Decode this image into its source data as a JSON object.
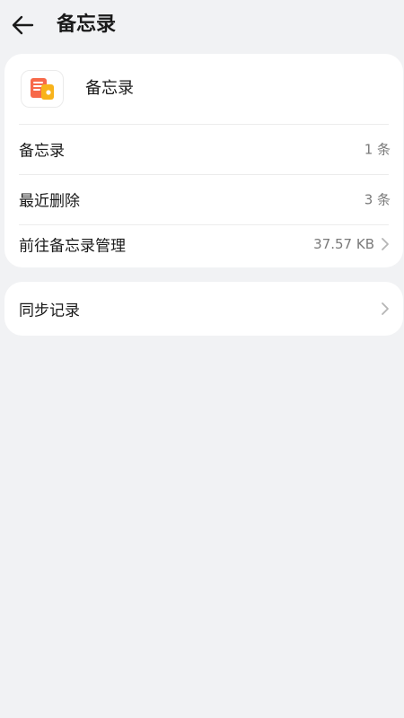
{
  "header": {
    "title": "备忘录",
    "back_icon": "back-arrow-icon"
  },
  "app": {
    "name": "备忘录",
    "icon": "notes-app-icon",
    "icon_colors": {
      "primary": "#f7694a",
      "secondary": "#f8b31b"
    }
  },
  "storage": {
    "rows": [
      {
        "label": "备忘录",
        "value": "1 条"
      },
      {
        "label": "最近删除",
        "value": "3 条"
      },
      {
        "label": "前往备忘录管理",
        "value": "37.57 KB",
        "chevron_icon": "chevron-right-icon"
      }
    ]
  },
  "sync": {
    "label": "同步记录",
    "chevron_icon": "chevron-right-icon"
  },
  "colors": {
    "background": "#f1f2f4",
    "card": "#ffffff",
    "secondary_text": "#7a7a7a"
  }
}
